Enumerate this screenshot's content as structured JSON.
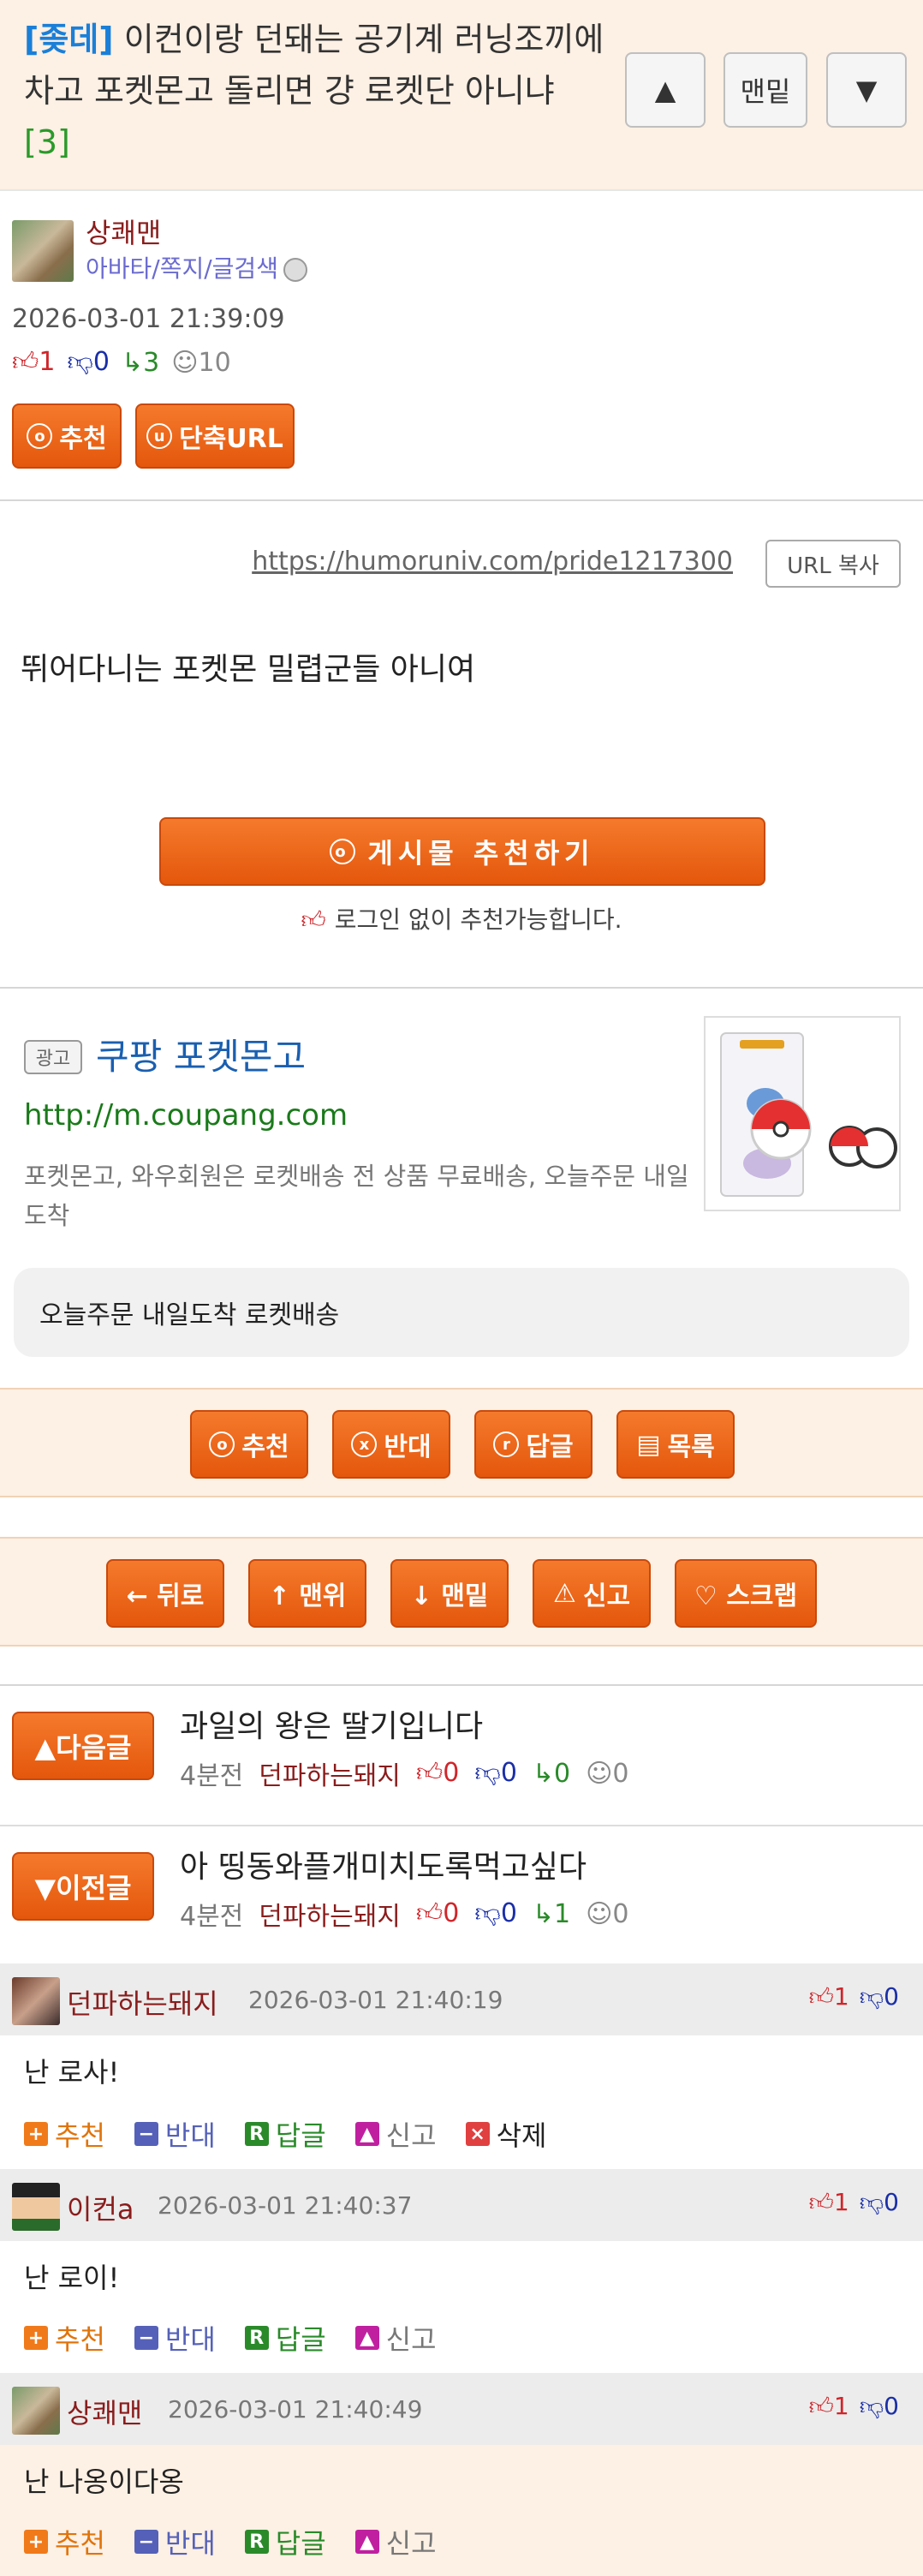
{
  "header": {
    "category": "[좆데]",
    "title": " 이컨이랑 던돼는 공기계 러닝조끼에 차고 포켓몬고 돌리면 걍 로켓단 아니냐 ",
    "reply_count": "[3]",
    "up_label": "▲",
    "bottom_label": "맨밑",
    "down_label": "▼"
  },
  "author": {
    "name": "상쾌맨",
    "links": "아바타/쪽지/글검색",
    "date": "2026-03-01 21:39:09",
    "stats": {
      "up": "1",
      "down": "0",
      "replies": "3",
      "views": "10"
    },
    "btn_recommend": "추천",
    "btn_short_url": "단축URL"
  },
  "url_row": {
    "url": "https://humoruniv.com/pride1217300",
    "copy_label": "URL 복사"
  },
  "content": {
    "text": "뛰어다니는 포켓몬 밀렵군들 아니여"
  },
  "recommend": {
    "label": "게시물 추천하기",
    "note": "로그인 없이 추천가능합니다."
  },
  "ad": {
    "badge": "광고",
    "title": "쿠팡 포켓몬고",
    "url": "http://m.coupang.com",
    "desc": "포켓몬고, 와우회원은 로켓배송 전 상품 무료배송, 오늘주문 내일도착",
    "cta": "오늘주문 내일도착 로켓배송"
  },
  "action_bar_1": {
    "recommend": "추천",
    "oppose": "반대",
    "reply": "답글",
    "list": "목록"
  },
  "action_bar_2": {
    "back": "← 뒤로",
    "top": "↑ 맨위",
    "bottom": "↓ 맨밑",
    "report": "신고",
    "scrap": "♡ 스크랩"
  },
  "next_post": {
    "tag": "▲다음글",
    "title": "과일의 왕은 딸기입니다",
    "ago": "4분전",
    "author": "던파하는돼지",
    "up": "0",
    "down": "0",
    "replies": "0",
    "views": "0"
  },
  "prev_post": {
    "tag": "▼이전글",
    "title": "아 띵동와플개미치도록먹고싶다",
    "ago": "4분전",
    "author": "던파하는돼지",
    "up": "0",
    "down": "0",
    "replies": "1",
    "views": "0"
  },
  "comments": [
    {
      "name": "던파하는돼지",
      "date": "2026-03-01 21:40:19",
      "up": "1",
      "down": "0",
      "body": "난 로사!"
    },
    {
      "name": "이컨a",
      "date": "2026-03-01 21:40:37",
      "up": "1",
      "down": "0",
      "body": "난 로이!"
    },
    {
      "name": "상쾌맨",
      "date": "2026-03-01 21:40:49",
      "up": "1",
      "down": "0",
      "body": "난 나옹이다옹"
    }
  ],
  "comment_actions": {
    "recommend": "추천",
    "oppose": "반대",
    "reply": "답글",
    "report": "신고",
    "delete": "삭제"
  },
  "colors": {
    "accent_orange": "#e4570c",
    "header_bg": "#fdf0e4",
    "category_blue": "#1a7fd8",
    "author_red": "#8a1c1c"
  }
}
